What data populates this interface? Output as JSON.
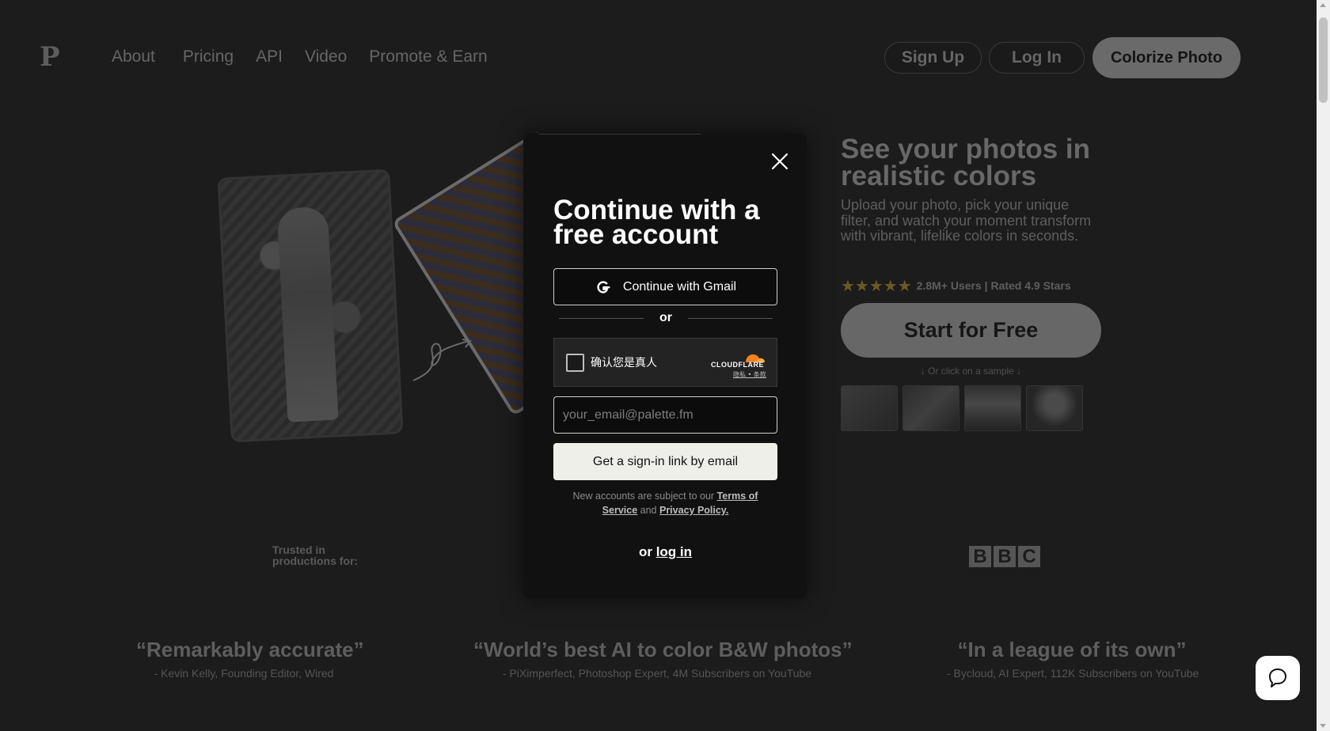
{
  "nav": {
    "logo": "P",
    "links": [
      "About",
      "Pricing",
      "API",
      "Video",
      "Promote & Earn"
    ],
    "signup": "Sign Up",
    "login": "Log In",
    "colorize": "Colorize Photo"
  },
  "hero": {
    "title": "See your photos in realistic colors",
    "subtitle": "Upload your photo, pick your unique filter, and watch your moment transform with vibrant, lifelike colors in seconds.",
    "stars": "★★★★★",
    "rating_text": "2.8M+ Users | Rated 4.9 Stars",
    "start_button": "Start for Free",
    "sample_hint": "↓ Or click on a sample ↓"
  },
  "trust": {
    "label": "Trusted in productions for:",
    "bbc": [
      "B",
      "B",
      "C"
    ]
  },
  "quotes": [
    {
      "quote": "“Remarkably accurate”",
      "author": "- Kevin Kelly, Founding Editor, Wired"
    },
    {
      "quote": "“World’s best AI to color B&W photos”",
      "author": "- PiXimperfect, Photoshop Expert, 4M Subscribers on YouTube"
    },
    {
      "quote": "“In a league of its own”",
      "author": "- Bycloud, AI Expert, 112K Subscribers on YouTube"
    }
  ],
  "modal": {
    "title": "Continue with a free account",
    "gmail_button": "Continue with Gmail",
    "or": "or",
    "captcha": {
      "label": "确认您是真人",
      "brand": "CLOUDFLARE",
      "links": "隐私 • 条款"
    },
    "email_placeholder": "your_email@palette.fm",
    "email_value": "",
    "signin_button": "Get a sign-in link by email",
    "terms_prefix": "New accounts are subject to our",
    "terms_link": "Terms of Service",
    "terms_and": "and",
    "privacy_link": "Privacy Policy.",
    "or_login_prefix": "or",
    "login_link": "log in"
  },
  "colors": {
    "modal_bg": "#111111",
    "page_bg": "#1c1c1c",
    "star": "#6b5a25"
  }
}
